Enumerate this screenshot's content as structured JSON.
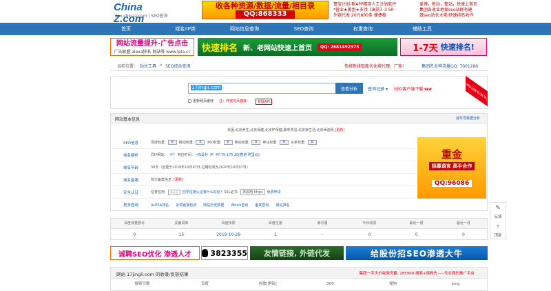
{
  "logo": {
    "brand": "China Z.com",
    "sub": "seo.chinaz.com | SEO查询"
  },
  "top_ad": {
    "line1": "收各种资源/数据/流量/相目录",
    "line2": "QQ:868333"
  },
  "top_text_left": [
    "寰宝计划-帮APP精准人工计划软件",
    "*营业★美团★多领《高防》3 5R",
    "外链代发 20元800条 便捷稳"
  ],
  "top_text_right": [
    "爱博，新站，整站，快速上首页",
    "集团各收业地保seo站群有建",
    "做seo站长大佬/快速排名收作"
  ],
  "nav": [
    "首页",
    "域名/IP类",
    "网站信息查询",
    "SEO查询",
    "权重查询",
    "辅助工具"
  ],
  "ad_b1": {
    "t1": "网站流量提升-广告点击",
    "t2": "广告联盟 alexa排名 网站等 www.lpla.cc"
  },
  "ad_b2": {
    "k1": "快速排名",
    "k2": "新、老网站快速上首页",
    "k3": "QQ: 2681492373"
  },
  "ad_b3": {
    "d1": "1-7天",
    "d2": "快速排名!"
  },
  "crumb": {
    "prefix": "当前位置：",
    "site": "站长工具",
    "sep": ">",
    "page": "SEO综合查询",
    "promo": "快排新排智能优化排代理，厂家!",
    "ad": "集团名全神流量QQ: 7001288"
  },
  "search": {
    "value": "17jingli.com",
    "button": "查看分析",
    "history": "查询记录",
    "query_sel": "▾",
    "seo_client": "SEO客户端下载",
    "new_badge": "NEW",
    "opt1": "更新网页缓存",
    "opt2": "注：开放向页面接",
    "opt3": "获取API",
    "corner": "网站排名优化"
  },
  "panel": {
    "title": "网站基本信息",
    "right": "威举号数据分析",
    "desc": "京困,北京养生,北京保健,北京怀保健,桑拿洗浴,北京夜生活,北京休验网",
    "update": "[更新]"
  },
  "seo_info": {
    "label": "SEO信息",
    "bd": "百度权重:",
    "bd_v": "0",
    "mobile": "移动权重:",
    "mobile_v": "0",
    "s360": "360权重:",
    "s360_v": "0",
    "sm": "移动权重:",
    "sm_v": "0",
    "sg": "神马权重:",
    "sg_v": "0",
    "tt": "头条权重:",
    "tt_v": "0"
  },
  "domain_parse": {
    "label": "域名解析",
    "ip_label": "同IP网站：",
    "ip_count": "4个",
    "resp": "响应时间：",
    "resp_v": "45毫秒",
    "ip": "IP: 47.75.175.20[香港 阿里云]"
  },
  "domain_age": {
    "label": "域名年龄",
    "v": "30天（创建于2019年10月07日,过期时间为2020年10月07日）"
  },
  "domain_icp": {
    "label": "域名备案",
    "v": "暂无备案信息",
    "update": "[更新]"
  },
  "security": {
    "label": "安全认证",
    "trust": "信誉信用:",
    "trust_badge": "未认证",
    "apply": "创学信用认证有什么好处?",
    "ssl": "SSL证书:",
    "ssl_v": "未启用 https",
    "free": "免费申请"
  },
  "more": {
    "label": "更多查询",
    "links": [
      "ALEXA排名",
      "友情链接检测",
      "网站历史数据",
      "Whois查询",
      "备案查询",
      "网站排名"
    ]
  },
  "side_ad": {
    "s1": "重金",
    "s2": "招募语言 高手合作",
    "s3": "QQ:96086"
  },
  "stats": {
    "headers": [
      "百度流量预计",
      "关键词库",
      "百度快照",
      "百度位置",
      "索引量",
      "今日收录",
      "最近一周",
      "最近一月"
    ],
    "values": [
      "0",
      "15",
      "2019-10-29",
      "1",
      "-",
      "0",
      "0",
      "0"
    ]
  },
  "bottom_ads": {
    "a1": "诚聘SEO优化 渗透人才",
    "a2": "3823355",
    "a3": "友情链接, 外链代发",
    "a4": "给股份招SEO渗透大牛"
  },
  "results": {
    "title": "网站 17jingli.com 的收录/反链结果",
    "right": "集团一手天价收购流量: 285969  搜索+偿救先-----专业爬的推广平台",
    "cols": [
      "搜索引擎",
      "百度",
      "谷歌[更新]",
      "360",
      "搜狗",
      "bing"
    ]
  },
  "float": {
    "fb": "反馈",
    "top": "顶部"
  }
}
